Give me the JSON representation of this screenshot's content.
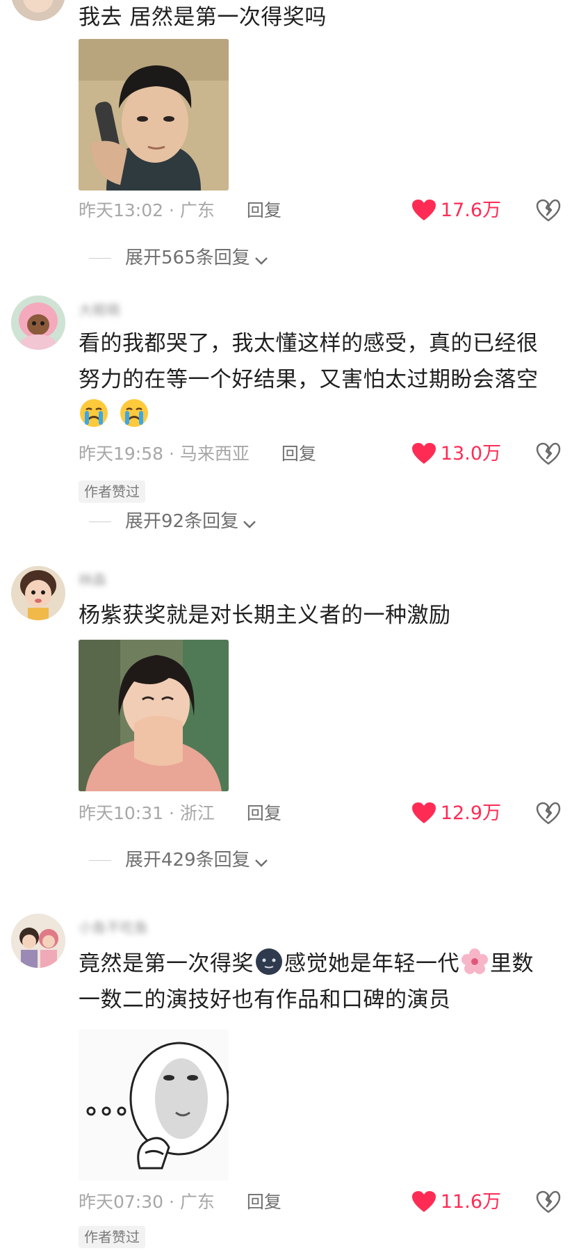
{
  "comments": [
    {
      "text": "我去 居然是第一次得奖吗",
      "time": "昨天13:02",
      "location": "广东",
      "reply_label": "回复",
      "likes": "17.6万",
      "expand_label": "展开565条回复"
    },
    {
      "username": "大眼萌",
      "text_line1": "看的我都哭了，我太懂这样的感受，真的已经很",
      "text_line2": "努力的在等一个好结果，又害怕太过期盼会落空",
      "time": "昨天19:58",
      "location": "马来西亚",
      "reply_label": "回复",
      "likes": "13.0万",
      "author_liked": "作者赞过",
      "expand_label": "展开92条回复"
    },
    {
      "username": "林森",
      "text": "杨紫获奖就是对长期主义者的一种激励",
      "time": "昨天10:31",
      "location": "浙江",
      "reply_label": "回复",
      "likes": "12.9万",
      "expand_label": "展开429条回复"
    },
    {
      "username": "小鱼不吃鱼",
      "text_part1": "竟然是第一次得奖",
      "text_part2": "感觉她是年轻一代",
      "text_part3": "里数",
      "text_line2": "一数二的演技好也有作品和口碑的演员",
      "time": "昨天07:30",
      "location": "广东",
      "reply_label": "回复",
      "likes": "11.6万",
      "author_liked": "作者赞过"
    }
  ],
  "meta_separator": "·",
  "colors": {
    "like": "#fe2c55",
    "muted": "#a7a7a7",
    "reply": "#6f6f6f",
    "text": "#1f1f1f"
  },
  "icons": {
    "like": "heart-icon",
    "dislike": "broken-heart-icon",
    "expand": "chevron-down-icon",
    "crying": "crying-face-emoji",
    "shy": "shy-face-emoji",
    "flower": "cherry-blossom-emoji"
  }
}
